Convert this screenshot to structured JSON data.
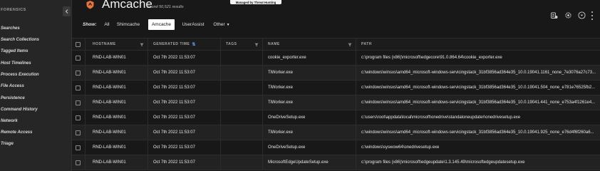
{
  "sidebar": {
    "title": "FORENSICS",
    "items": [
      {
        "label": "Searches"
      },
      {
        "label": "Search Collections"
      },
      {
        "label": "Tagged Items"
      },
      {
        "label": "Host Timelines"
      },
      {
        "label": "Process Execution"
      },
      {
        "label": "File Access"
      },
      {
        "label": "Persistence"
      },
      {
        "label": "Command History"
      },
      {
        "label": "Network"
      },
      {
        "label": "Remote Access"
      },
      {
        "label": "Triage"
      }
    ]
  },
  "header": {
    "title": "Amcache",
    "found": "Found 50,521 results",
    "banner": "Managed by Threat Hunting",
    "icons": [
      "export-icon",
      "settings-gear-icon",
      "filter-dropdown-icon",
      "more-icon"
    ]
  },
  "filters": {
    "show_label": "Show:",
    "tabs": [
      {
        "label": "All"
      },
      {
        "label": "Shimcache"
      },
      {
        "label": "Amcache"
      },
      {
        "label": "UserAssist"
      },
      {
        "label": "Other"
      }
    ],
    "active": "Amcache"
  },
  "table": {
    "columns": [
      "HOSTNAME",
      "GENERATED TIME",
      "TAGS",
      "NAME",
      "PATH"
    ],
    "rows": [
      {
        "hostname": "RND-LAB-WIN01",
        "time": "Oct 7th 2022 11:53:07",
        "tags": "",
        "name": "cookie_exporter.exe",
        "path": "c:\\program files (x86)\\microsoft\\edgecore\\91.0.864.64\\cookie_exporter.exe"
      },
      {
        "hostname": "RND-LAB-WIN01",
        "time": "Oct 7th 2022 11:53:07",
        "tags": "",
        "name": "TiWorker.exe",
        "path": "c:\\windows\\winsxs\\amd64_microsoft-windows-servicingstack_31bf3856ad364e35_10.0.19041.1161_none_7e3076a27c73..."
      },
      {
        "hostname": "RND-LAB-WIN01",
        "time": "Oct 7th 2022 11:53:07",
        "tags": "",
        "name": "TiWorker.exe",
        "path": "c:\\windows\\winsxs\\amd64_microsoft-windows-servicingstack_31bf3856ad364e35_10.0.19041.504_none_e781e76525fb2..."
      },
      {
        "hostname": "RND-LAB-WIN01",
        "time": "Oct 7th 2022 11:53:07",
        "tags": "",
        "name": "TiWorker.exe",
        "path": "c:\\windows\\winsxs\\amd64_microsoft-windows-servicingstack_31bf3856ad364e35_10.0.19041.441_none_e753a4f1261e4..."
      },
      {
        "hostname": "RND-LAB-WIN01",
        "time": "Oct 7th 2022 11:53:07",
        "tags": "",
        "name": "OneDriveSetup.exe",
        "path": "c:\\users\\root\\appdata\\local\\microsoft\\onedrive\\standaloneupdater\\onedrivesetup.exe"
      },
      {
        "hostname": "RND-LAB-WIN01",
        "time": "Oct 7th 2022 11:53:07",
        "tags": "",
        "name": "TiWorker.exe",
        "path": "c:\\windows\\winsxs\\amd64_microsoft-windows-servicingstack_31bf3856ad364e35_10.0.19041.925_none_e76d4f6f260a6..."
      },
      {
        "hostname": "RND-LAB-WIN01",
        "time": "Oct 7th 2022 11:53:07",
        "tags": "",
        "name": "OneDriveSetup.exe",
        "path": "c:\\windows\\syswow64\\onedrivesetup.exe"
      },
      {
        "hostname": "RND-LAB-WIN01",
        "time": "Oct 7th 2022 11:53:07",
        "tags": "",
        "name": "MicrosoftEdgeUpdateSetup.exe",
        "path": "c:\\program files (x86)\\microsoft\\edgeupdate\\1.3.145.49\\microsoftedgeupdatesetup.exe"
      }
    ]
  },
  "colors": {
    "background": "#181818",
    "sidebar": "#262626",
    "active_tab": "#ffffff",
    "logo": "#e8743b",
    "sort_accent": "#6aa9ff"
  }
}
